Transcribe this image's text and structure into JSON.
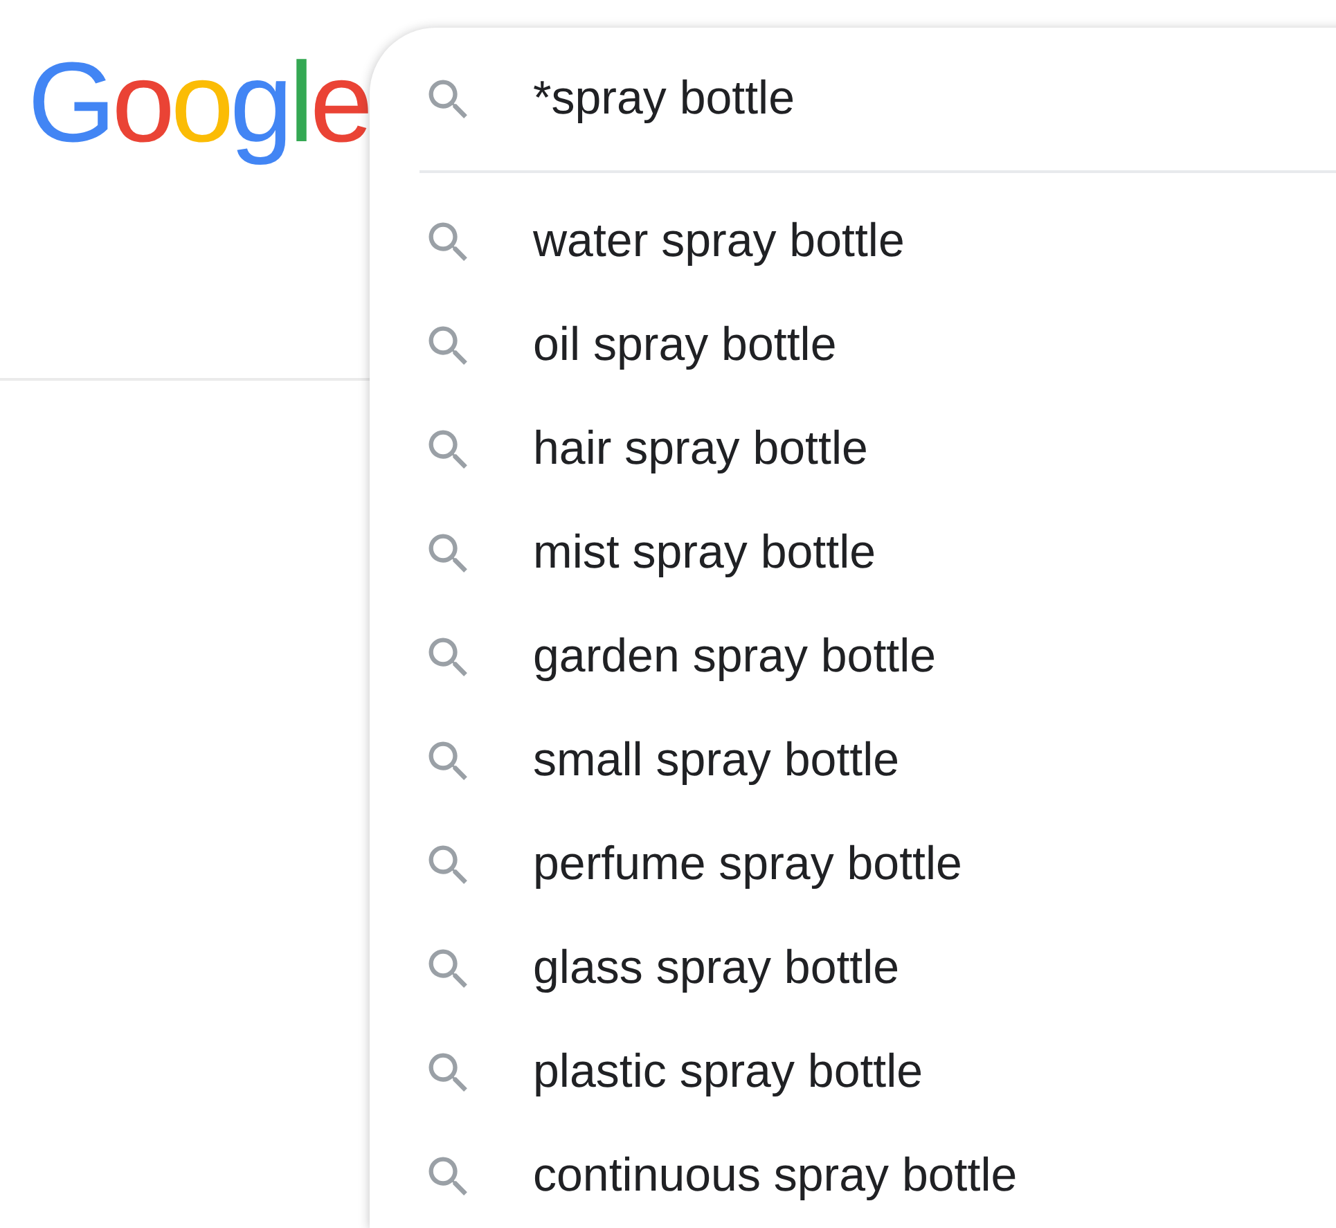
{
  "logo": {
    "letters": [
      {
        "char": "G",
        "color": "#4285f4"
      },
      {
        "char": "o",
        "color": "#ea4335"
      },
      {
        "char": "o",
        "color": "#fbbc05"
      },
      {
        "char": "g",
        "color": "#4285f4"
      },
      {
        "char": "l",
        "color": "#34a853"
      },
      {
        "char": "e",
        "color": "#ea4335"
      }
    ]
  },
  "search": {
    "value": "*spray bottle"
  },
  "suggestions": [
    "water spray bottle",
    "oil spray bottle",
    "hair spray bottle",
    "mist spray bottle",
    "garden spray bottle",
    "small spray bottle",
    "perfume spray bottle",
    "glass spray bottle",
    "plastic spray bottle",
    "continuous spray bottle"
  ]
}
